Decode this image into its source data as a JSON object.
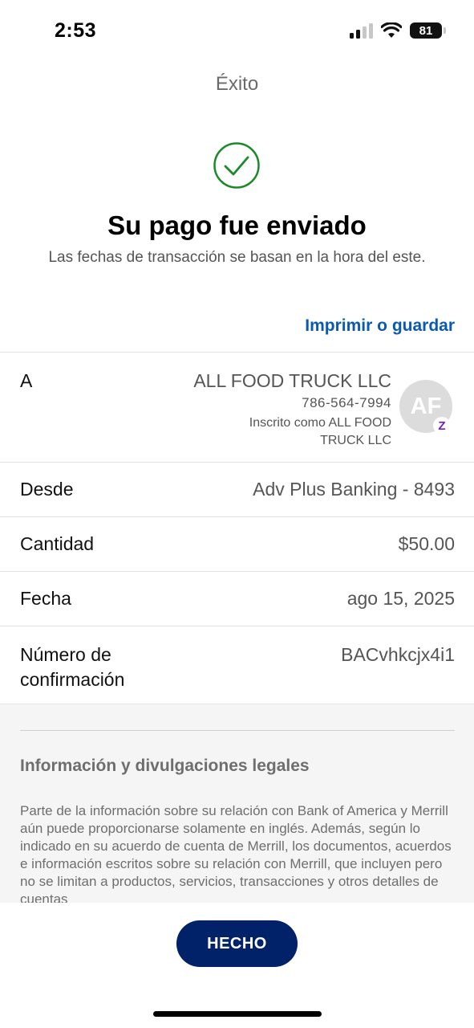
{
  "status_bar": {
    "time": "2:53",
    "battery": "81"
  },
  "header": {
    "screen_title": "Éxito",
    "main_title": "Su pago fue enviado",
    "subtitle": "Las fechas de transacción se basan en la hora del este.",
    "print_link": "Imprimir o guardar"
  },
  "details": {
    "to": {
      "label": "A",
      "name": "ALL FOOD TRUCK LLC",
      "phone": "786-564-7994",
      "enrolled": "Inscrito como ALL FOOD TRUCK LLC",
      "avatar_initials": "AF",
      "badge": "Z"
    },
    "from": {
      "label": "Desde",
      "value": "Adv Plus Banking - 8493"
    },
    "amount": {
      "label": "Cantidad",
      "value": "$50.00"
    },
    "date": {
      "label": "Fecha",
      "value": "ago 15, 2025"
    },
    "confirmation": {
      "label": "Número de confirmación",
      "value": "BACvhkcjx4i1"
    }
  },
  "legal": {
    "title": "Información y divulgaciones legales",
    "body": "Parte de la información sobre su relación con Bank of America y Merrill aún puede proporcionarse solamente en inglés. Además, según lo indicado en su acuerdo de cuenta de Merrill, los documentos, acuerdos e información escritos sobre su relación con Merrill, que incluyen pero no se limitan a productos, servicios, transacciones y otros detalles de cuentas"
  },
  "done_button": {
    "label": "HECHO"
  },
  "colors": {
    "accent_link": "#0a5ab4",
    "success_green": "#1a8a2a",
    "button_navy": "#012169",
    "zelle_purple": "#6d1ed4"
  },
  "icons": {
    "success": "check-circle-icon",
    "signal": "cellular-signal-icon",
    "wifi": "wifi-icon",
    "battery": "battery-icon",
    "zelle": "zelle-icon"
  }
}
